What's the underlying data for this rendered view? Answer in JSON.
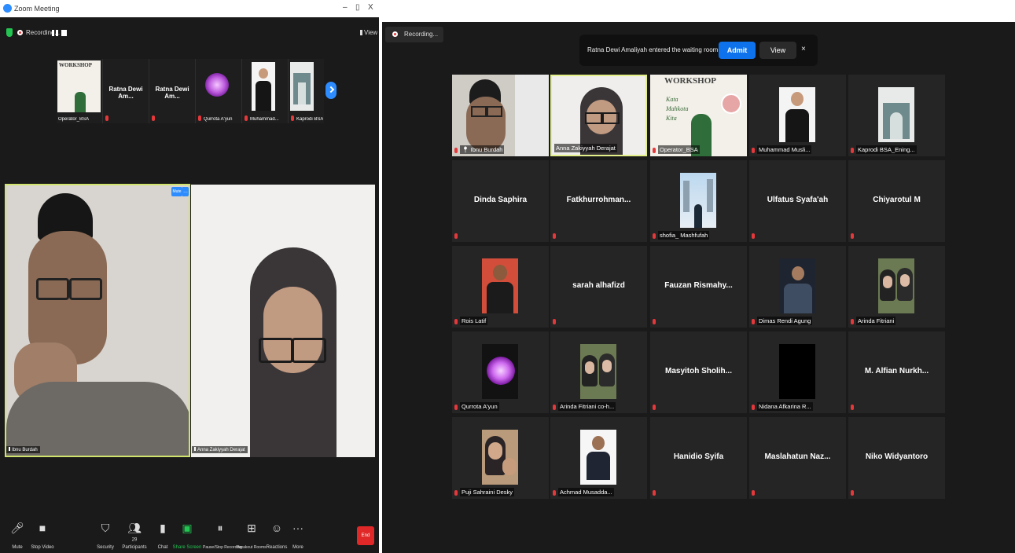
{
  "left_window": {
    "title": "Zoom Meeting",
    "window_controls": [
      "–",
      "▯",
      "X"
    ],
    "recording_label": "Recording...",
    "view_label": "View",
    "strip": [
      {
        "label": "Operator_BSA"
      },
      {
        "name": "Ratna Dewi Am..."
      },
      {
        "name": "Ratna Dewi Am..."
      },
      {
        "label": "Qurrota A'yun"
      },
      {
        "label": "Muhammad..."
      },
      {
        "label": "Kaprodi BSA..."
      }
    ],
    "video1_label": "Ibnu Burdah",
    "video2_label": "Anna Zakiyyah Derajat",
    "mute_btn": "Mute",
    "toolbar": [
      {
        "icon": "mic-icon",
        "label": "Mute"
      },
      {
        "icon": "video-icon",
        "label": "Stop Video"
      },
      {
        "icon": "shield-icon",
        "label": "Security"
      },
      {
        "icon": "participants-icon",
        "label": "Participants",
        "count": "29"
      },
      {
        "icon": "chat-icon",
        "label": "Chat"
      },
      {
        "icon": "share-icon",
        "label": "Share Screen"
      },
      {
        "icon": "pause-icon",
        "label": "Pause/Stop Recording"
      },
      {
        "icon": "breakout-icon",
        "label": "Breakout Rooms"
      },
      {
        "icon": "reactions-icon",
        "label": "Reactions"
      },
      {
        "icon": "more-icon",
        "label": "More"
      }
    ],
    "end_label": "End"
  },
  "right_window": {
    "recording_label": "Recording...",
    "banner": {
      "text": "Ratna Dewi Amaliyah entered the waiting room",
      "admit": "Admit",
      "view": "View",
      "close": "×"
    },
    "tiles": [
      {
        "label": "Ibnu Burdah",
        "type": "video"
      },
      {
        "label": "Anna Zakiyyah Derajat",
        "type": "video",
        "active": true
      },
      {
        "label": "Operator_BSA",
        "type": "video"
      },
      {
        "label": "Muhammad Musli...",
        "type": "photo"
      },
      {
        "label": "Kaprodi BSA_Ening...",
        "type": "photo"
      },
      {
        "name": "Dinda Saphira",
        "type": "name"
      },
      {
        "name": "Fatkhurrohman...",
        "type": "name"
      },
      {
        "label": "shofia_ Mashfufah",
        "type": "photo"
      },
      {
        "name": "Ulfatus Syafa'ah",
        "type": "name"
      },
      {
        "name": "Chiyarotul M",
        "type": "name"
      },
      {
        "label": "Rois Latif",
        "type": "photo"
      },
      {
        "name": "sarah alhafizd",
        "type": "name"
      },
      {
        "name": "Fauzan Rismahy...",
        "type": "name"
      },
      {
        "label": "Dimas Rendi Agung",
        "type": "photo"
      },
      {
        "label": "Arinda Fitriani",
        "type": "photo"
      },
      {
        "label": "Qurrota A'yun",
        "type": "photo"
      },
      {
        "label": "Arinda Fitriani co-h...",
        "type": "photo"
      },
      {
        "name": "Masyitoh Sholih...",
        "type": "name"
      },
      {
        "label": "Nidana Afkarina R...",
        "type": "photo"
      },
      {
        "name": "M. Alfian Nurkh...",
        "type": "name"
      },
      {
        "label": "Puji Sahraini Desky",
        "type": "photo"
      },
      {
        "label": "Achmad Musadda...",
        "type": "photo"
      },
      {
        "name": "Hanidio Syifa",
        "type": "name"
      },
      {
        "name": "Maslahatun Naz...",
        "type": "name"
      },
      {
        "name": "Niko Widyantoro",
        "type": "name"
      }
    ],
    "workshop_banner": {
      "title": "WORKSHOP",
      "subtitle": "Kata Mahkota Kita"
    }
  },
  "colors": {
    "accent_blue": "#0e72ed",
    "mic_muted": "#e5383b",
    "active_speaker": "#e3f08a",
    "tile_bg": "#252525",
    "window_bg": "#1a1a1a"
  }
}
